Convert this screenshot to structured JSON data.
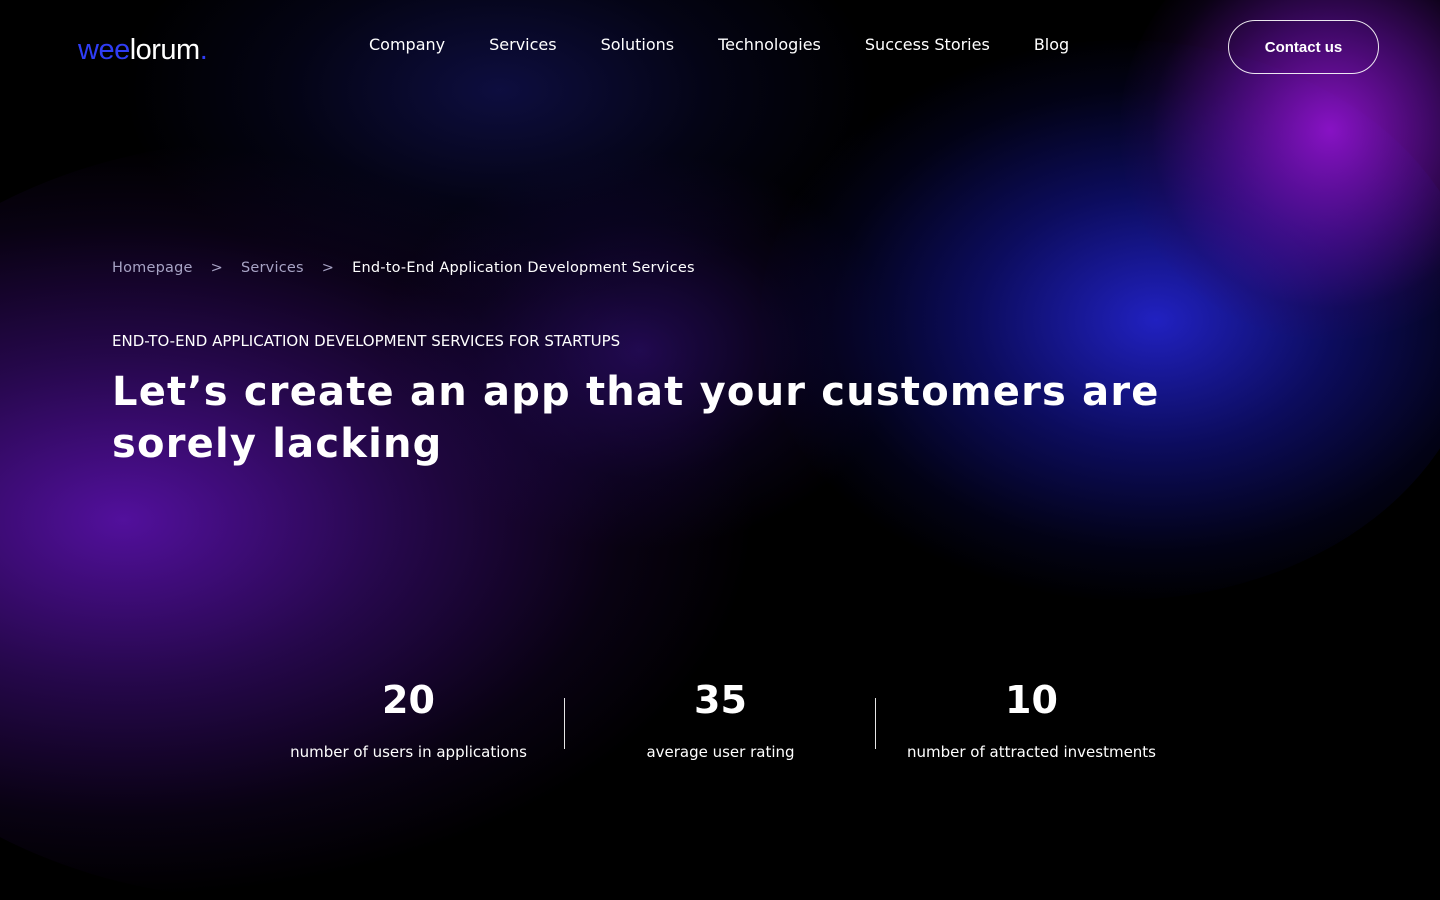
{
  "logo": {
    "part1": "wee",
    "part2": "lorum",
    "part3": "."
  },
  "nav": {
    "items": [
      {
        "label": "Company"
      },
      {
        "label": "Services"
      },
      {
        "label": "Solutions"
      },
      {
        "label": "Technologies"
      },
      {
        "label": "Success Stories"
      },
      {
        "label": "Blog"
      }
    ],
    "contact_label": "Contact us"
  },
  "breadcrumb": {
    "items": [
      {
        "label": "Homepage"
      },
      {
        "label": "Services"
      }
    ],
    "separator": ">",
    "current": "End-to-End Application Development Services"
  },
  "hero": {
    "eyebrow": "END-TO-END APPLICATION DEVELOPMENT SERVICES FOR STARTUPS",
    "headline": "Let’s create an app that your customers are sorely lacking"
  },
  "stats": [
    {
      "value": "20",
      "label": "number of users in applications"
    },
    {
      "value": "35",
      "label": "average user rating"
    },
    {
      "value": "10",
      "label": "number of attracted investments"
    }
  ],
  "colors": {
    "background": "#000000",
    "brand_blue": "#2f3df5",
    "glow_blue": "#2828eb",
    "glow_violet": "#9614d7",
    "breadcrumb_muted": "#a7a3c4"
  }
}
